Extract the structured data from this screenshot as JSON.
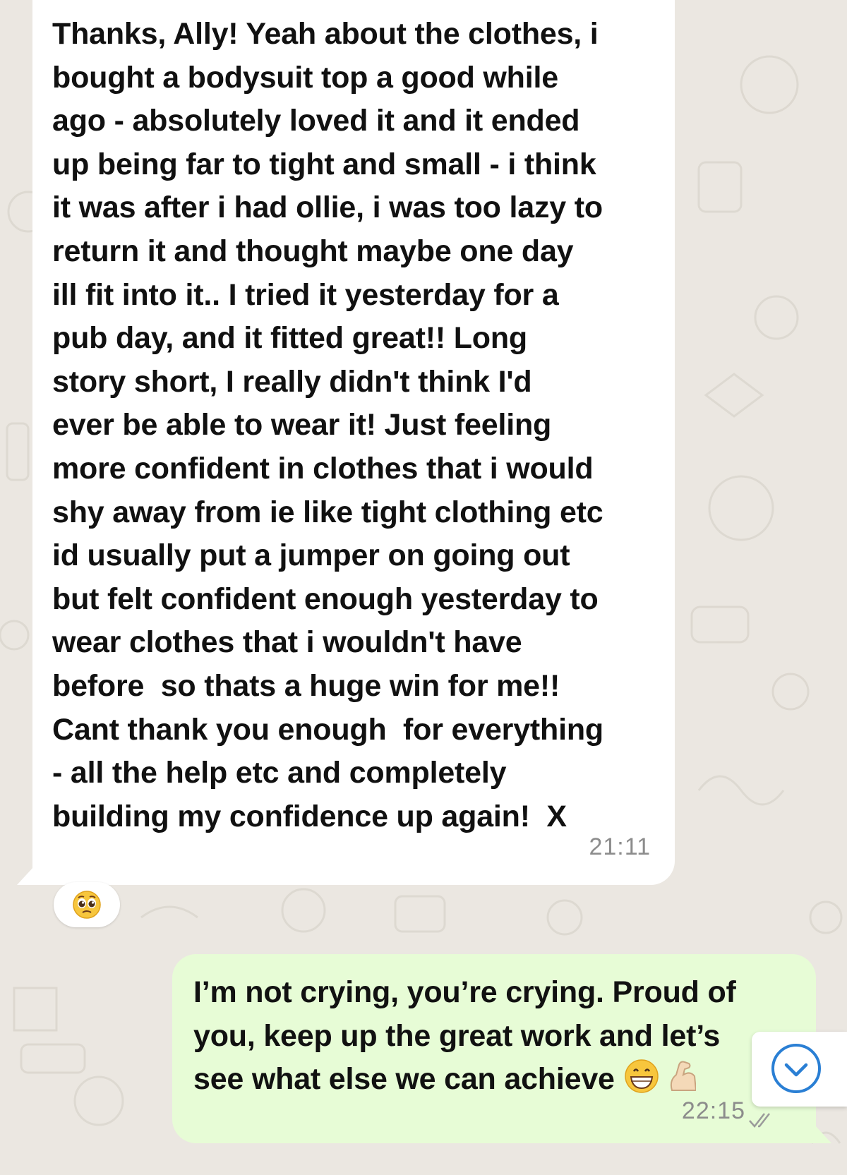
{
  "chat": {
    "incoming": {
      "text": "Thanks, Ally! Yeah about the clothes, i\nbought a bodysuit top a good while\nago - absolutely loved it and it ended\nup being far to tight and small - i think\nit was after i had ollie, i was too lazy to\nreturn it and thought maybe one day\nill fit into it.. I tried it yesterday for a\npub day, and it fitted great!! Long\nstory short, I really didn't think I'd\never be able to wear it! Just feeling\nmore confident in clothes that i would\nshy away from ie like tight clothing etc\nid usually put a jumper on going out\nbut felt confident enough yesterday to\nwear clothes that i wouldn't have\nbefore  so thats a huge win for me!!\nCant thank you enough  for everything\n- all the help etc and completely\nbuilding my confidence up again!  X",
      "time": "21:11",
      "reaction_icon": "pleading-face-emoji"
    },
    "outgoing": {
      "line1": "I’m not crying, you’re crying. Proud of",
      "line2": "you, keep up the great work and let’s",
      "line3": "see what else we can achieve",
      "emoji_1": "grinning-face-emoji",
      "emoji_2": "flexed-biceps-emoji",
      "time": "22:15",
      "status_icon": "double-check-icon"
    },
    "scroll_button_icon": "chevron-down-icon"
  },
  "colors": {
    "background": "#ebe7e1",
    "incoming_bubble": "#ffffff",
    "outgoing_bubble": "#e7fcd6",
    "timestamp": "#8c8c8c",
    "accent": "#2a7fd4"
  }
}
